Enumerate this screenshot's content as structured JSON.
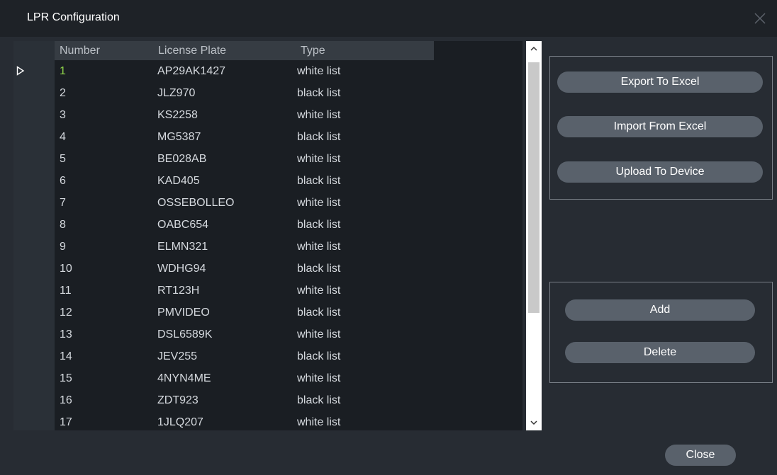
{
  "window": {
    "title": "LPR Configuration",
    "close_icon": "close-icon"
  },
  "table": {
    "columns": [
      "Number",
      "License Plate",
      "Type"
    ],
    "selected_row_index": 0,
    "rows": [
      {
        "number": "1",
        "plate": "AP29AK1427",
        "type": "white list"
      },
      {
        "number": "2",
        "plate": "JLZ970",
        "type": "black list"
      },
      {
        "number": "3",
        "plate": "KS2258",
        "type": "white list"
      },
      {
        "number": "4",
        "plate": "MG5387",
        "type": "black list"
      },
      {
        "number": "5",
        "plate": "BE028AB",
        "type": "white list"
      },
      {
        "number": "6",
        "plate": "KAD405",
        "type": "black list"
      },
      {
        "number": "7",
        "plate": "OSSEBOLLEO",
        "type": "white list"
      },
      {
        "number": "8",
        "plate": "OABC654",
        "type": "black list"
      },
      {
        "number": "9",
        "plate": "ELMN321",
        "type": "white list"
      },
      {
        "number": "10",
        "plate": "WDHG94",
        "type": "black list"
      },
      {
        "number": "11",
        "plate": "RT123H",
        "type": "white list"
      },
      {
        "number": "12",
        "plate": "PMVIDEO",
        "type": "black list"
      },
      {
        "number": "13",
        "plate": "DSL6589K",
        "type": "white list"
      },
      {
        "number": "14",
        "plate": "JEV255",
        "type": "black list"
      },
      {
        "number": "15",
        "plate": "4NYN4ME",
        "type": "white list"
      },
      {
        "number": "16",
        "plate": "ZDT923",
        "type": "black list"
      },
      {
        "number": "17",
        "plate": "1JLQ207",
        "type": "white list"
      }
    ]
  },
  "actions": {
    "export": "Export To Excel",
    "import": "Import From Excel",
    "upload": "Upload To Device",
    "add": "Add",
    "delete": "Delete",
    "close": "Close"
  },
  "colors": {
    "background": "#272c33",
    "titlebar": "#1e2227",
    "button": "#59616b",
    "selected_number": "#8fd44a"
  }
}
